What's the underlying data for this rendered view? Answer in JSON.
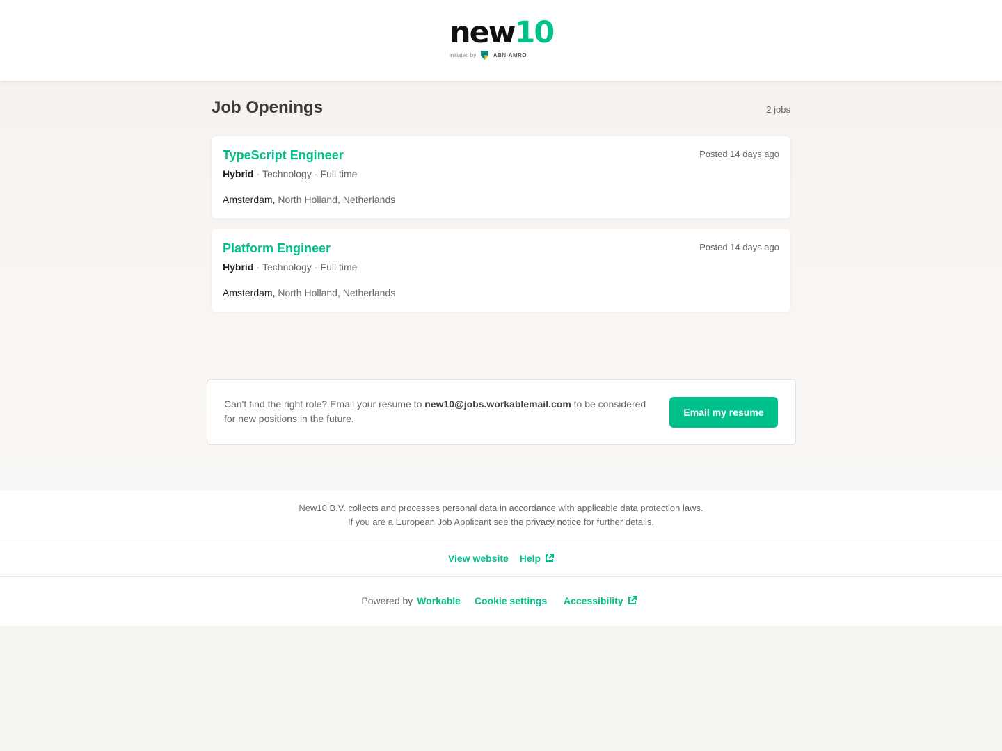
{
  "header": {
    "logo_dark": "new",
    "logo_green": "10",
    "logo_initiated": "initiated by",
    "logo_partner": "ABN·AMRO"
  },
  "main": {
    "title": "Job Openings",
    "count": "2 jobs"
  },
  "jobs": [
    {
      "title": "TypeScript Engineer",
      "posted": "Posted 14 days ago",
      "workplace": "Hybrid",
      "department": "Technology",
      "type": "Full time",
      "city": "Amsterdam,",
      "region": "North Holland, Netherlands"
    },
    {
      "title": "Platform Engineer",
      "posted": "Posted 14 days ago",
      "workplace": "Hybrid",
      "department": "Technology",
      "type": "Full time",
      "city": "Amsterdam,",
      "region": "North Holland, Netherlands"
    }
  ],
  "resume": {
    "text_before": "Can't find the right role? Email your resume to ",
    "email": "new10@jobs.workablemail.com",
    "text_after": " to be considered for new positions in the future.",
    "button_label": "Email my resume"
  },
  "footer": {
    "privacy_line1": "New10 B.V. collects and processes personal data in accordance with applicable data protection laws.",
    "privacy_line2_before": "If you are a European Job Applicant see the ",
    "privacy_link": "privacy notice",
    "privacy_line2_after": " for further details.",
    "view_website": "View website",
    "help": "Help",
    "powered_by": "Powered by",
    "workable": "Workable",
    "cookie_settings": "Cookie settings",
    "accessibility": "Accessibility"
  },
  "colors": {
    "accent": "#00c08b",
    "page_bg": "#f6f5f2"
  }
}
